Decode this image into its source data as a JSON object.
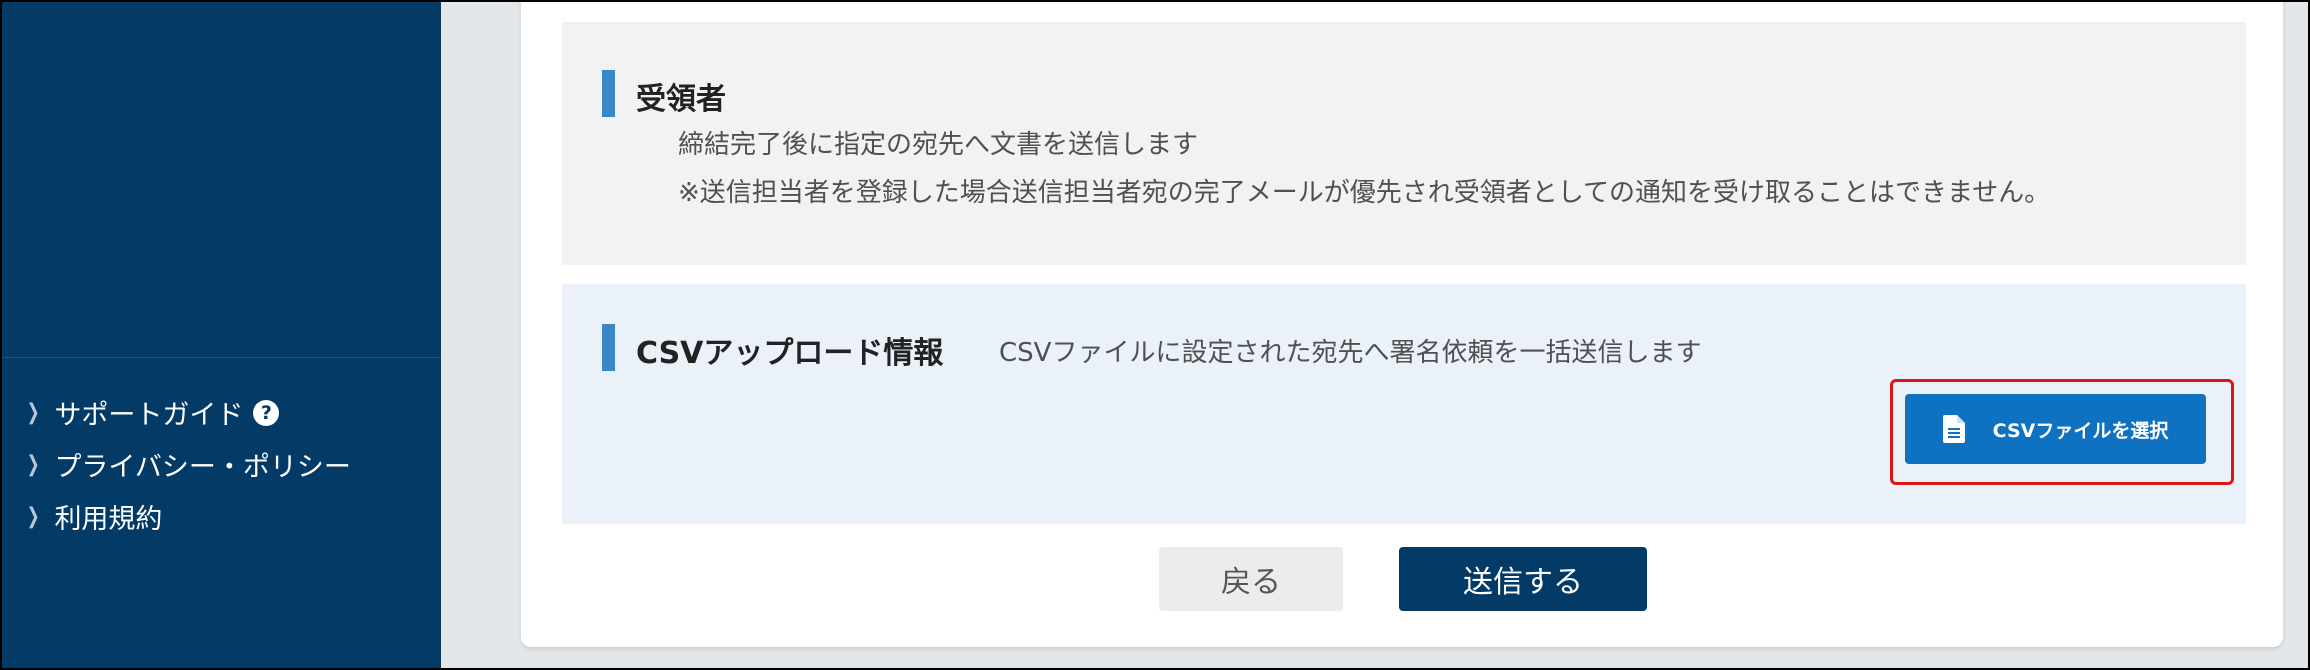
{
  "sidebar": {
    "links": [
      {
        "label": "サポートガイド",
        "icon": "help-circle-icon"
      },
      {
        "label": "プライバシー・ポリシー"
      },
      {
        "label": "利用規約"
      }
    ]
  },
  "recipient": {
    "title": "受領者",
    "description_1": "締結完了後に指定の宛先へ文書を送信します",
    "description_2": "※送信担当者を登録した場合送信担当者宛の完了メールが優先され受領者としての通知を受け取ることはできません。"
  },
  "csv_upload": {
    "title": "CSVアップロード情報",
    "description": "CSVファイルに設定された宛先へ署名依頼を一括送信します",
    "button_label": "CSVファイルを選択",
    "button_icon": "document-icon"
  },
  "actions": {
    "back_label": "戻る",
    "send_label": "送信する"
  },
  "colors": {
    "sidebar": "#033a66",
    "accent": "#0f71c1",
    "highlight": "#e01414"
  }
}
